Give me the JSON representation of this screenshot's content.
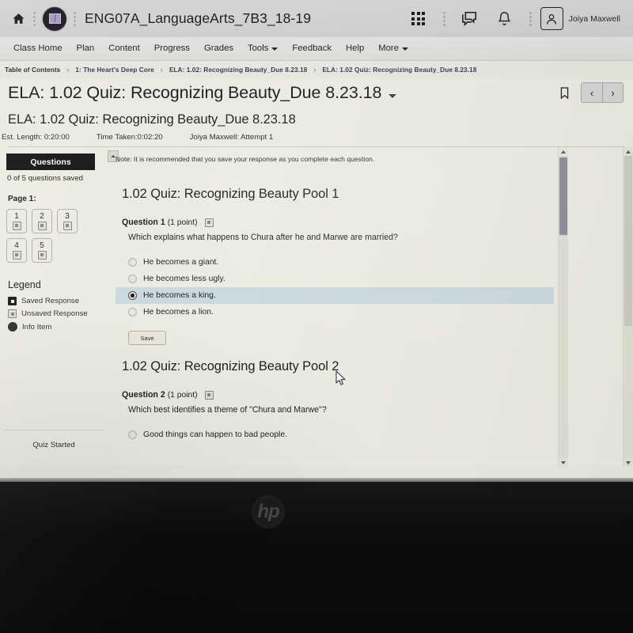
{
  "topbar": {
    "home_icon": "home-icon",
    "course_logo_icon": "course-logo-icon",
    "course_title": "ENG07A_LanguageArts_7B3_18-19",
    "waffle_icon": "app-grid-icon",
    "messages_icon": "chat-bubbles-icon",
    "notifications_icon": "bell-icon",
    "avatar_icon": "user-avatar-icon",
    "user_name": "Joiya Maxwell"
  },
  "navbar": {
    "items": [
      {
        "label": "Class Home",
        "caret": false
      },
      {
        "label": "Plan",
        "caret": false
      },
      {
        "label": "Content",
        "caret": false
      },
      {
        "label": "Progress",
        "caret": false
      },
      {
        "label": "Grades",
        "caret": false
      },
      {
        "label": "Tools",
        "caret": true
      },
      {
        "label": "Feedback",
        "caret": false
      },
      {
        "label": "Help",
        "caret": false
      },
      {
        "label": "More",
        "caret": true
      }
    ]
  },
  "breadcrumb": {
    "separator": "›",
    "items": [
      "Table of Contents",
      "1: The Heart's Deep Core",
      "ELA: 1.02: Recognizing Beauty_Due 8.23.18",
      "ELA: 1.02 Quiz: Recognizing Beauty_Due 8.23.18"
    ]
  },
  "page": {
    "title": "ELA: 1.02 Quiz: Recognizing Beauty_Due 8.23.18",
    "bookmark_icon": "bookmark-icon",
    "prev_label": "‹",
    "next_label": "›"
  },
  "quiz_header": {
    "name": "ELA: 1.02 Quiz: Recognizing Beauty_Due 8.23.18",
    "est_length": "Est. Length: 0:20:00",
    "time_taken": "Time Taken:0:02:20",
    "attempt": "Joiya Maxwell: Attempt 1"
  },
  "questions_panel": {
    "header": "Questions",
    "saved_status": "0 of 5 questions saved",
    "page_label": "Page 1:",
    "question_buttons": [
      "1",
      "2",
      "3",
      "4",
      "5"
    ],
    "legend_title": "Legend",
    "legend": [
      {
        "icon": "saved-response-icon",
        "label": "Saved Response"
      },
      {
        "icon": "unsaved-response-icon",
        "label": "Unsaved Response"
      },
      {
        "icon": "info-item-icon",
        "label": "Info Item"
      }
    ],
    "quiz_started": "Quiz Started",
    "collapse_icon": "collapse-panel-icon"
  },
  "content": {
    "note": "Note: It is recommended that you save your response as you complete each question.",
    "pools": [
      {
        "title": "1.02 Quiz: Recognizing Beauty Pool 1",
        "question": {
          "label": "Question 1",
          "points": "(1 point)",
          "info_icon": "question-info-icon",
          "text": "Which explains what happens to Chura after he and Marwe are married?",
          "options": [
            {
              "label": "He becomes a giant.",
              "selected": false
            },
            {
              "label": "He becomes less ugly.",
              "selected": false
            },
            {
              "label": "He becomes a king.",
              "selected": true
            },
            {
              "label": "He becomes a lion.",
              "selected": false
            }
          ],
          "save_label": "Save"
        }
      },
      {
        "title": "1.02 Quiz: Recognizing Beauty Pool 2",
        "question": {
          "label": "Question 2",
          "points": "(1 point)",
          "info_icon": "question-info-icon",
          "text": "Which best identifies a theme of \"Chura and Marwe\"?",
          "options": [
            {
              "label": "Good things can happen to bad people.",
              "selected": false
            }
          ]
        }
      }
    ]
  },
  "device": {
    "brand_logo": "hp"
  },
  "colors": {
    "page_background": "#efeee5",
    "topbar": "#d6d7d6",
    "navbar": "#e0e0de",
    "panel_header": "#161616",
    "selected_option_highlight": "#ccdce0",
    "breadcrumb_link": "#2f3d53",
    "bezel": "#0c0c0e"
  }
}
